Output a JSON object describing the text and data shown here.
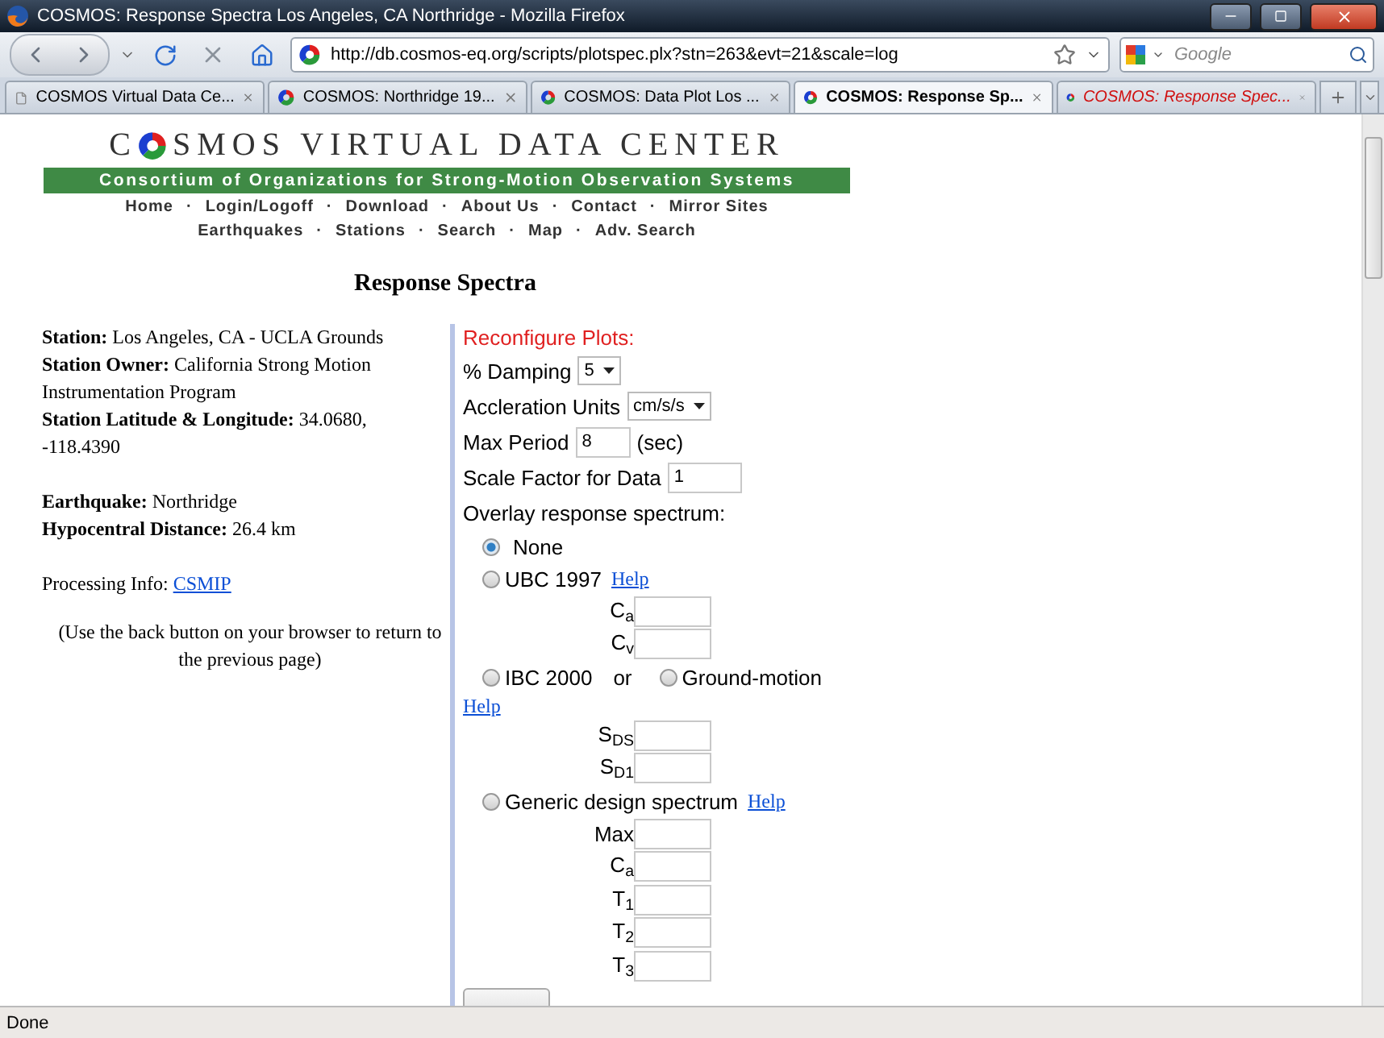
{
  "window": {
    "title": "COSMOS: Response Spectra Los Angeles, CA Northridge - Mozilla Firefox"
  },
  "toolbar": {
    "url": "http://db.cosmos-eq.org/scripts/plotspec.plx?stn=263&evt=21&scale=log",
    "search_placeholder": "Google"
  },
  "tabs": [
    {
      "label": "COSMOS Virtual Data Ce...",
      "kind": "blank",
      "selected": false,
      "color": "#000000"
    },
    {
      "label": "COSMOS: Northridge 19...",
      "kind": "site",
      "selected": false,
      "color": "#000000"
    },
    {
      "label": "COSMOS: Data Plot Los ...",
      "kind": "site",
      "selected": false,
      "color": "#000000"
    },
    {
      "label": "COSMOS: Response Sp...",
      "kind": "site",
      "selected": true,
      "color": "#000000"
    },
    {
      "label": "COSMOS: Response Spec...",
      "kind": "site",
      "selected": false,
      "color": "#d01010"
    }
  ],
  "page": {
    "logo": {
      "first": "C",
      "rest": "SMOS VIRTUAL DATA CENTER"
    },
    "banner": "Consortium of Organizations for Strong-Motion Observation Systems",
    "separator": "·",
    "nav": [
      [
        "Home",
        "Login/Logoff",
        "Download",
        "About Us",
        "Contact",
        "Mirror Sites"
      ],
      [
        "Earthquakes",
        "Stations",
        "Search",
        "Map",
        "Adv. Search"
      ]
    ],
    "heading": "Response Spectra",
    "info": [
      [
        "**Station:** Los Angeles, CA - UCLA Grounds",
        "**Station Owner:** California Strong Motion Instrumentation Program",
        "**Station Latitude & Longitude:** 34.0680, -118.4390"
      ],
      [
        "**Earthquake:** Northridge",
        "**Hypocentral Distance:** 26.4 km"
      ]
    ],
    "processing": {
      "label": "Processing Info:",
      "link": "CSMIP"
    },
    "note": "(Use the back button on your browser to return to the previous page)",
    "form": {
      "title": "Reconfigure Plots:",
      "fields": [
        {
          "kind": "select",
          "label": "% Damping",
          "value": "5"
        },
        {
          "kind": "select",
          "label": "Accleration Units",
          "value": "cm/s/s"
        },
        {
          "kind": "input",
          "label": "Max Period",
          "value": "8",
          "suffix": "(sec)"
        },
        {
          "kind": "input",
          "label": "Scale Factor for Data",
          "value": "1"
        }
      ],
      "overlay": {
        "label": "Overlay response spectrum:",
        "options": [
          {
            "kind": "single",
            "label": "None",
            "selected": true
          },
          {
            "kind": "single",
            "label": "UBC 1997",
            "selected": false,
            "help": "Help",
            "params": [
              "C$_{a}$",
              "C$_{v}$"
            ]
          },
          {
            "kind": "pair",
            "label": "IBC 2000",
            "selected": false,
            "conjunction": "or",
            "alt_label": "Ground-motion",
            "alt_selected": false,
            "help": "Help",
            "params": [
              "S$_{DS}$",
              "S$_{D1}$"
            ]
          },
          {
            "kind": "single",
            "label": "Generic design spectrum",
            "selected": false,
            "help": "Help",
            "params": [
              "Max",
              "C$_{a}$",
              "T$_{1}$",
              "T$_{2}$",
              "T$_{3}$"
            ]
          }
        ]
      }
    }
  },
  "status_bar": {
    "text": "Done"
  }
}
